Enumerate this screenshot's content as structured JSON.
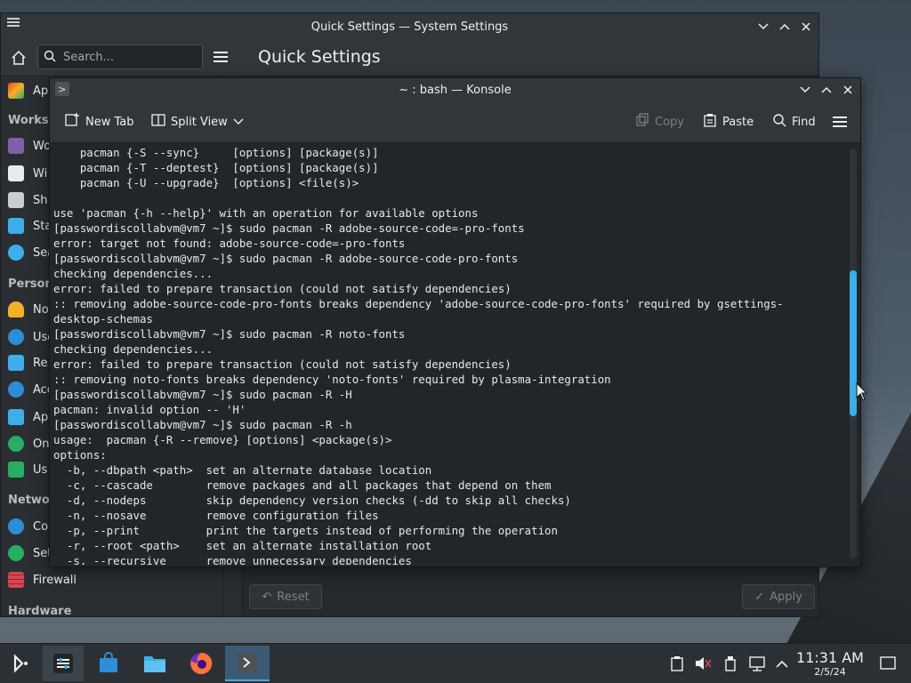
{
  "settings_window": {
    "title": "Quick Settings — System Settings",
    "search_placeholder": "Search...",
    "page_title": "Quick Settings",
    "sidebar": {
      "items_top": [
        {
          "label": "Ap",
          "color": "#e8491d"
        }
      ],
      "section_workspace": "Worksp",
      "items_workspace": [
        {
          "label": "Wo",
          "color": "#7f5fa8"
        },
        {
          "label": "Wi",
          "color": "#e9ecef"
        },
        {
          "label": "Sh",
          "color": "#c9cdd1"
        },
        {
          "label": "Sta",
          "color": "#3daee9"
        },
        {
          "label": "Sea",
          "color": "#3daee9"
        }
      ],
      "section_personal": "Persona",
      "items_personal": [
        {
          "label": "No",
          "color": "#f5b129"
        },
        {
          "label": "Use",
          "color": "#2d8ed6"
        },
        {
          "label": "Re",
          "color": "#3daee9"
        },
        {
          "label": "Acc",
          "color": "#2d8ed6"
        },
        {
          "label": "Ap",
          "color": "#3daee9"
        },
        {
          "label": "On",
          "color": "#27ae60"
        },
        {
          "label": "Us",
          "color": "#27ae60"
        }
      ],
      "section_network": "Netwo",
      "items_network": [
        {
          "label": "Co",
          "color": "#2d8ed6"
        },
        {
          "label": "Set",
          "color": "#27ae60"
        },
        {
          "label": "Firewall",
          "color": "#da4453"
        }
      ],
      "section_hardware": "Hardware"
    },
    "footer": {
      "reset_label": "Reset",
      "apply_label": "Apply"
    }
  },
  "konsole": {
    "title": "~ : bash — Konsole",
    "toolbar": {
      "new_tab": "New Tab",
      "split_view": "Split View",
      "copy": "Copy",
      "paste": "Paste",
      "find": "Find"
    },
    "lines": [
      "    pacman {-S --sync}     [options] [package(s)]",
      "    pacman {-T --deptest}  [options] [package(s)]",
      "    pacman {-U --upgrade}  [options] <file(s)>",
      "",
      "use 'pacman {-h --help}' with an operation for available options",
      "[passwordiscollabvm@vm7 ~]$ sudo pacman -R adobe-source-code=-pro-fonts",
      "error: target not found: adobe-source-code=-pro-fonts",
      "[passwordiscollabvm@vm7 ~]$ sudo pacman -R adobe-source-code-pro-fonts",
      "checking dependencies...",
      "error: failed to prepare transaction (could not satisfy dependencies)",
      ":: removing adobe-source-code-pro-fonts breaks dependency 'adobe-source-code-pro-fonts' required by gsettings-",
      "desktop-schemas",
      "[passwordiscollabvm@vm7 ~]$ sudo pacman -R noto-fonts",
      "checking dependencies...",
      "error: failed to prepare transaction (could not satisfy dependencies)",
      ":: removing noto-fonts breaks dependency 'noto-fonts' required by plasma-integration",
      "[passwordiscollabvm@vm7 ~]$ sudo pacman -R -H",
      "pacman: invalid option -- 'H'",
      "[passwordiscollabvm@vm7 ~]$ sudo pacman -R -h",
      "usage:  pacman {-R --remove} [options] <package(s)>",
      "options:",
      "  -b, --dbpath <path>  set an alternate database location",
      "  -c, --cascade        remove packages and all packages that depend on them",
      "  -d, --nodeps         skip dependency version checks (-dd to skip all checks)",
      "  -n, --nosave         remove configuration files",
      "  -p, --print          print the targets instead of performing the operation",
      "  -r, --root <path>    set an alternate installation root",
      "  -s, --recursive      remove unnecessary dependencies"
    ]
  },
  "taskbar": {
    "clock_time": "11:31 AM",
    "clock_date": "2/5/24"
  }
}
